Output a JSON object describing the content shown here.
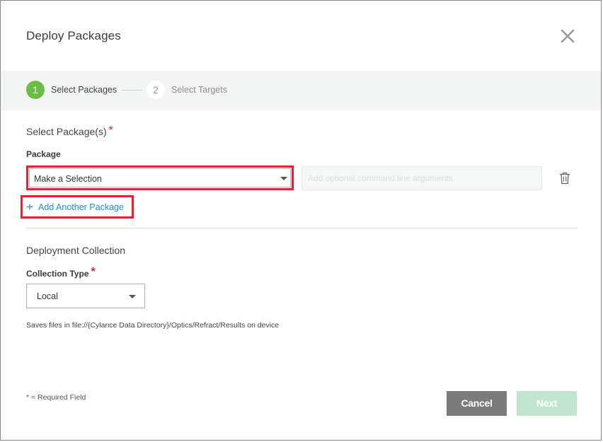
{
  "dialog": {
    "title": "Deploy Packages"
  },
  "stepper": {
    "steps": [
      {
        "number": "1",
        "label": "Select Packages"
      },
      {
        "number": "2",
        "label": "Select Targets"
      }
    ]
  },
  "packages": {
    "section_title": "Select Package(s)",
    "required_marker": "*",
    "field_label": "Package",
    "select_value": "Make a Selection",
    "args_placeholder": "Add optional command line arguments",
    "add_another_label": "Add Another Package",
    "add_icon": "+"
  },
  "collection": {
    "section_title": "Deployment Collection",
    "field_label": "Collection Type",
    "required_marker": "*",
    "select_value": "Local",
    "help_text": "Saves files in file://{Cylance Data Directory}/Optics/Refract/Results on device"
  },
  "footer": {
    "required_note": "* = Required Field",
    "cancel_label": "Cancel",
    "next_label": "Next"
  },
  "colors": {
    "accent_green": "#6cbd45",
    "link_blue": "#1b8fd0",
    "required_red": "#d9264a",
    "highlight_red": "#e8232e",
    "cancel_gray": "#7b7b7b",
    "next_disabled": "#c1e6cd"
  }
}
